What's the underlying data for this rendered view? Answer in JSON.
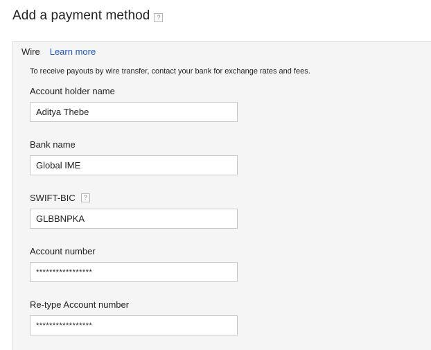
{
  "page": {
    "title": "Add a payment method",
    "title_help": "?"
  },
  "panel": {
    "method_name": "Wire",
    "learn_more": "Learn more",
    "info_text": "To receive payouts by wire transfer, contact your bank for exchange rates and fees."
  },
  "fields": {
    "account_holder": {
      "label": "Account holder name",
      "value": "Aditya Thebe"
    },
    "bank_name": {
      "label": "Bank name",
      "value": "Global IME"
    },
    "swift_bic": {
      "label": "SWIFT-BIC",
      "help": "?",
      "value": "GLBBNPKA"
    },
    "account_number": {
      "label": "Account number",
      "value": "*****************"
    },
    "retype_account_number": {
      "label": "Re-type Account number",
      "value": "*****************"
    }
  },
  "icons": {
    "help": "question-mark-icon"
  },
  "colors": {
    "link": "#1a55c9",
    "panel_bg": "#f5f5f5",
    "input_border": "#c8c8c8"
  }
}
